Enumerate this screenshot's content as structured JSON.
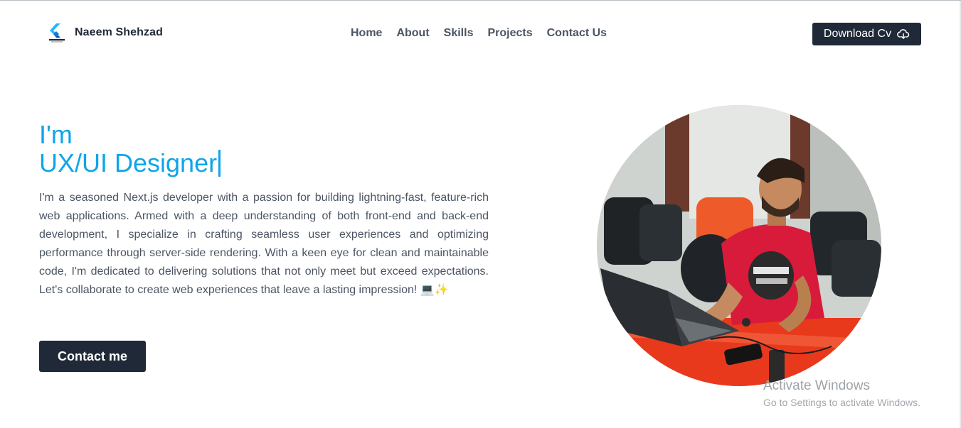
{
  "navbar": {
    "brand_name": "Naeem Shehzad",
    "links": [
      "Home",
      "About",
      "Skills",
      "Projects",
      "Contact Us"
    ],
    "download_label": "Download Cv",
    "download_icon": "cloud-download-icon"
  },
  "hero": {
    "intro": "I'm",
    "role": "UX/UI Designer",
    "description": "I'm a seasoned Next.js developer with a passion for building lightning-fast, feature-rich web applications. Armed with a deep understanding of both front-end and back-end development, I specialize in crafting seamless user experiences and optimizing performance through server-side rendering. With a keen eye for clean and maintainable code, I'm dedicated to delivering solutions that not only meet but exceed expectations. Let's collaborate to create web experiences that leave a lasting impression! 💻✨",
    "contact_label": "Contact me"
  },
  "watermark": {
    "title": "Activate Windows",
    "subtitle": "Go to Settings to activate Windows."
  },
  "colors": {
    "accent": "#0ea5e9",
    "dark": "#1f2937",
    "text": "#4b5563"
  }
}
